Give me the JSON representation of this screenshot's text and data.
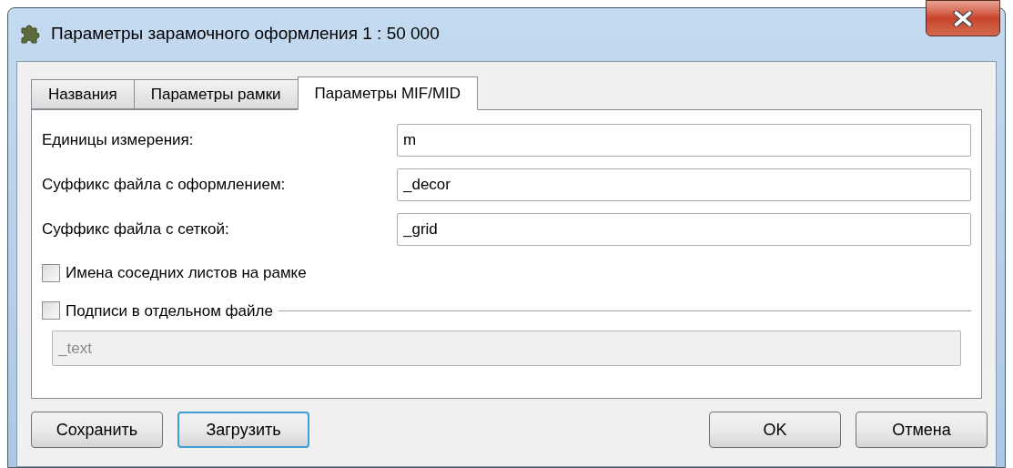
{
  "window": {
    "title": "Параметры зарамочного оформления 1 : 50 000"
  },
  "tabs": [
    {
      "label": "Названия",
      "selected": false
    },
    {
      "label": "Параметры рамки",
      "selected": false
    },
    {
      "label": "Параметры MIF/MID",
      "selected": true
    }
  ],
  "fields": [
    {
      "label": "Единицы измерения:",
      "value": "m"
    },
    {
      "label": "Суффикс файла с оформлением:",
      "value": "_decor"
    },
    {
      "label": "Суффикс файла с сеткой:",
      "value": "_grid"
    }
  ],
  "neighbor_names": {
    "label": "Имена соседних листов на рамке",
    "checked": false
  },
  "labels_group": {
    "label": "Подписи в отдельном файле",
    "checked": false,
    "field": {
      "value": "_text",
      "disabled": true
    }
  },
  "buttons_left": [
    {
      "label": "Сохранить",
      "focused": false
    },
    {
      "label": "Загрузить",
      "focused": true
    }
  ],
  "buttons_right": [
    {
      "label": "OK",
      "focused": false
    },
    {
      "label": "Отмена",
      "focused": false
    }
  ]
}
